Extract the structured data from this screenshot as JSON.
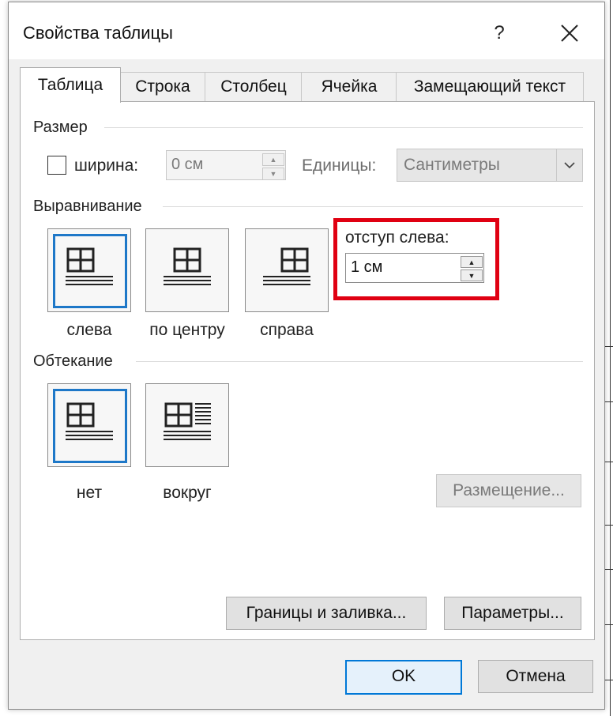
{
  "dialog": {
    "title": "Свойства таблицы",
    "help_label": "?",
    "close_icon": "close-icon"
  },
  "tabs": [
    {
      "label": "Таблица",
      "active": true
    },
    {
      "label": "Строка",
      "active": false
    },
    {
      "label": "Столбец",
      "active": false
    },
    {
      "label": "Ячейка",
      "active": false
    },
    {
      "label": "Замещающий текст",
      "active": false
    }
  ],
  "size": {
    "group_label": "Размер",
    "width_label": "ширина:",
    "width_checked": false,
    "width_value": "0 см",
    "units_label": "Единицы:",
    "units_value": "Сантиметры"
  },
  "alignment": {
    "group_label": "Выравнивание",
    "options": [
      {
        "label": "слева",
        "selected": true,
        "icon": "align-left-icon"
      },
      {
        "label": "по центру",
        "selected": false,
        "icon": "align-center-icon"
      },
      {
        "label": "справа",
        "selected": false,
        "icon": "align-right-icon"
      }
    ],
    "indent_label": "отступ слева:",
    "indent_value": "1 см",
    "highlight_color": "#e00012"
  },
  "wrapping": {
    "group_label": "Обтекание",
    "options": [
      {
        "label": "нет",
        "selected": true,
        "icon": "wrap-none-icon"
      },
      {
        "label": "вокруг",
        "selected": false,
        "icon": "wrap-around-icon"
      }
    ],
    "positioning_label": "Размещение..."
  },
  "buttons": {
    "borders_label": "Границы и заливка...",
    "options_label": "Параметры...",
    "ok_label": "OK",
    "cancel_label": "Отмена"
  },
  "colors": {
    "accent": "#1e78c8",
    "default_button_border": "#0078d7"
  }
}
